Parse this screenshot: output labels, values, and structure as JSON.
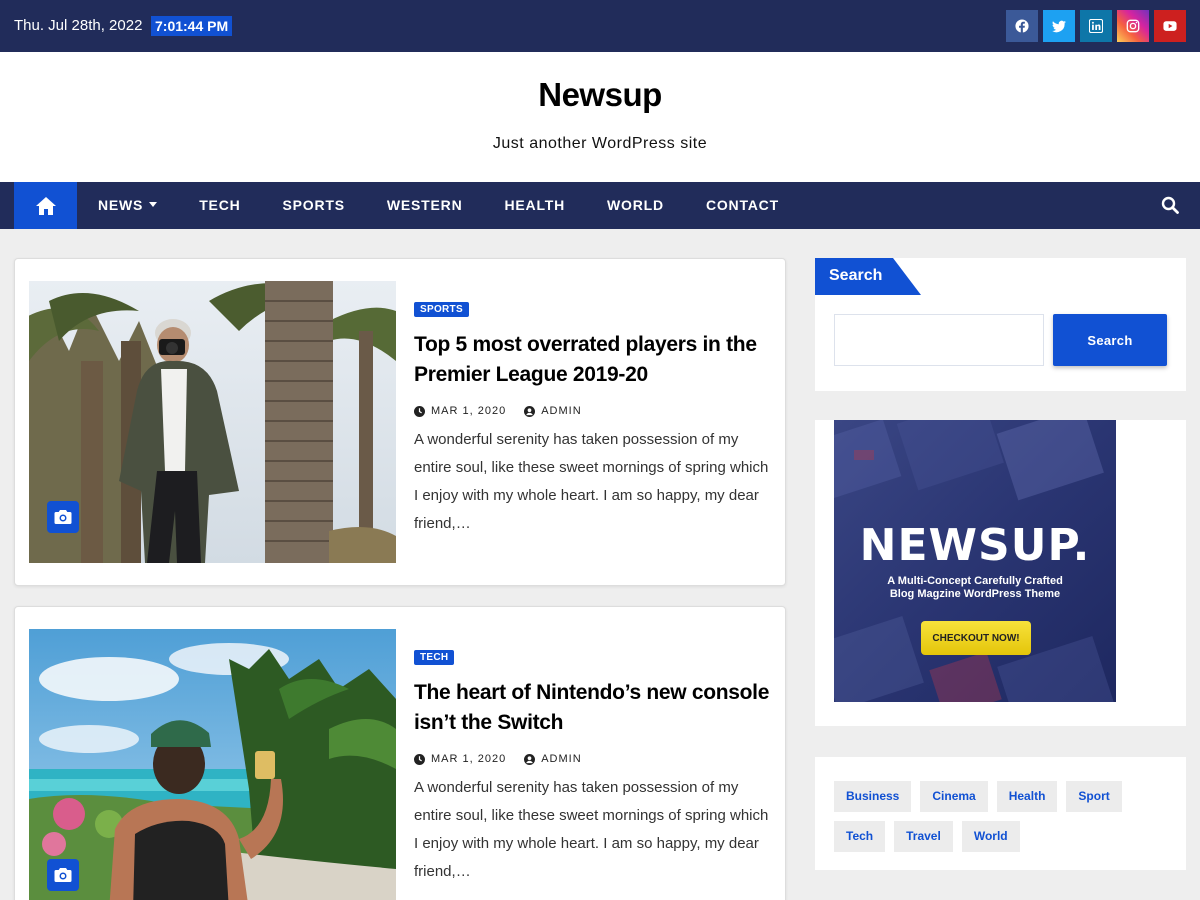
{
  "topbar": {
    "date": "Thu. Jul 28th, 2022",
    "time": "7:01:44 PM",
    "socials": [
      {
        "name": "facebook-icon",
        "color": "#3b5998"
      },
      {
        "name": "twitter-icon",
        "color": "#1da1f2"
      },
      {
        "name": "linkedin-icon",
        "color": "#0e76a8"
      },
      {
        "name": "instagram-icon",
        "color": "#d6249f"
      },
      {
        "name": "youtube-icon",
        "color": "#cd201f"
      }
    ]
  },
  "header": {
    "title": "Newsup",
    "description": "Just another WordPress site"
  },
  "nav": {
    "items": [
      "NEWS",
      "TECH",
      "SPORTS",
      "WESTERN",
      "HEALTH",
      "WORLD",
      "CONTACT"
    ]
  },
  "posts": [
    {
      "category": "SPORTS",
      "title": "Top 5 most overrated players in the Premier League 2019-20",
      "date": "MAR 1, 2020",
      "author": "ADMIN",
      "excerpt": "A wonderful serenity has taken possession of my entire soul, like these sweet mornings of spring which I enjoy with my whole heart. I am so happy, my dear friend,…"
    },
    {
      "category": "TECH",
      "title": "The heart of Nintendo’s new console isn’t the Switch",
      "date": "MAR 1, 2020",
      "author": "ADMIN",
      "excerpt": "A wonderful serenity has taken possession of my entire soul, like these sweet mornings of spring which I enjoy with my whole heart. I am so happy, my dear friend,…"
    }
  ],
  "sidebar": {
    "search_title": "Search",
    "search_button": "Search",
    "ad": {
      "logo": "NEWSUP.",
      "tagline1": "A Multi-Concept Carefully Crafted",
      "tagline2": "Blog Magzine WordPress Theme",
      "cta": "CHECKOUT NOW!"
    },
    "tags": [
      "Business",
      "Cinema",
      "Health",
      "Sport",
      "Tech",
      "Travel",
      "World"
    ]
  },
  "colors": {
    "navy": "#212c5a",
    "accent": "#1151d3"
  }
}
